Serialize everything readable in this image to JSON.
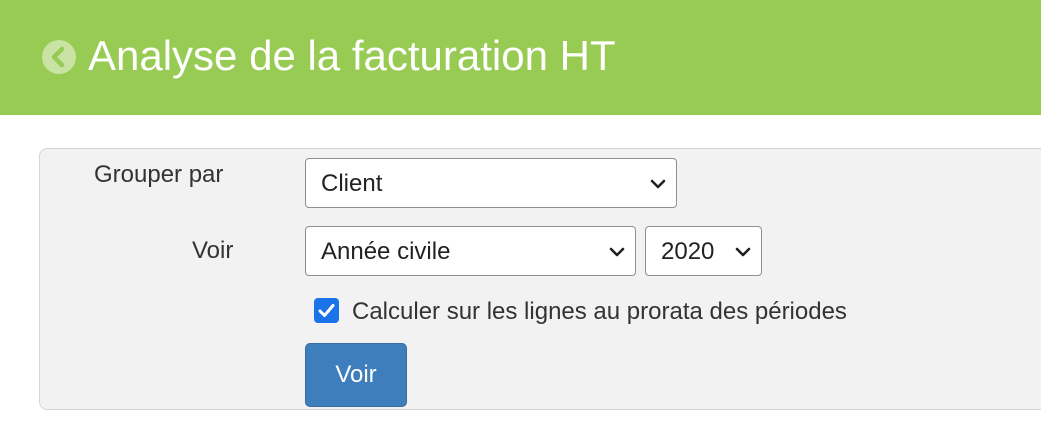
{
  "header": {
    "title": "Analyse de la facturation HT",
    "back_icon": "chevron-left-circle-icon",
    "background_color": "#98cb53"
  },
  "form": {
    "group_by": {
      "label": "Grouper par",
      "selected": "Client"
    },
    "view": {
      "label": "Voir",
      "period_selected": "Année civile",
      "year_selected": "2020"
    },
    "prorata": {
      "label": "Calculer sur les lignes au prorata des périodes",
      "checked": true
    },
    "submit_label": "Voir",
    "submit_color": "#3f7ebc"
  }
}
